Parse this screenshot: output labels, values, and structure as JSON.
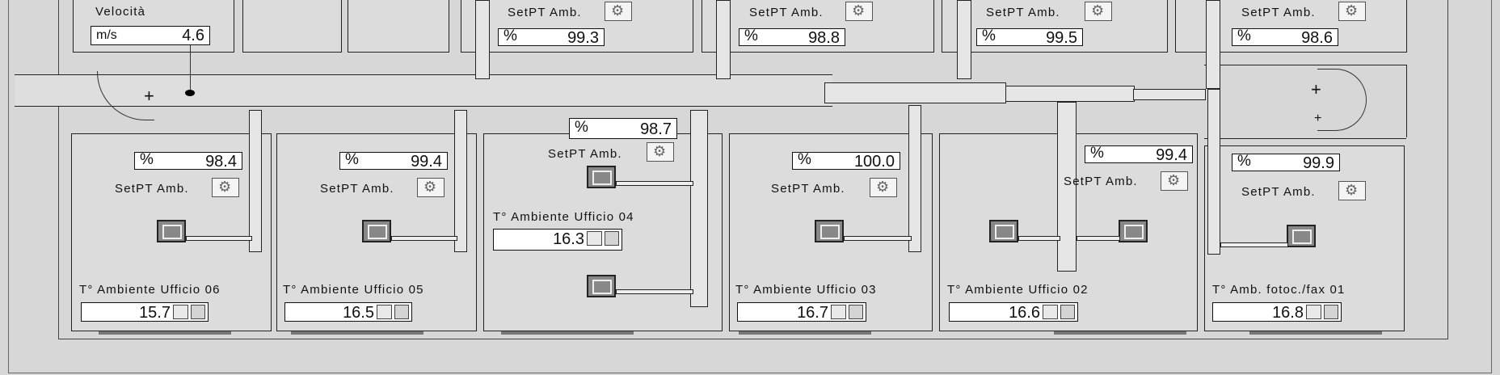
{
  "velocity": {
    "label": "Velocità",
    "unit": "m/s",
    "value": "4.6"
  },
  "setpt_label": "SetPT Amb.",
  "percent_unit": "%",
  "top_setpoints": [
    "99.3",
    "98.8",
    "99.5",
    "98.6"
  ],
  "offices": [
    {
      "name": "T° Ambiente Ufficio 06",
      "temp": "15.7",
      "setpt": "98.4"
    },
    {
      "name": "T° Ambiente Ufficio 05",
      "temp": "16.5",
      "setpt": "99.4"
    },
    {
      "name": "T° Ambiente Ufficio 04",
      "temp": "16.3",
      "setpt": "98.7"
    },
    {
      "name": "T° Ambiente Ufficio 03",
      "temp": "16.7",
      "setpt": "100.0"
    },
    {
      "name": "T° Ambiente Ufficio 02",
      "temp": "16.6",
      "setpt": "99.4"
    },
    {
      "name": "T° Amb. fotoc./fax 01",
      "temp": "16.8",
      "setpt": "99.9"
    }
  ],
  "icons": {
    "settings": "gear-settings-icon",
    "trend": "trend-chart-icon",
    "diffuser": "air-diffuser-icon"
  }
}
